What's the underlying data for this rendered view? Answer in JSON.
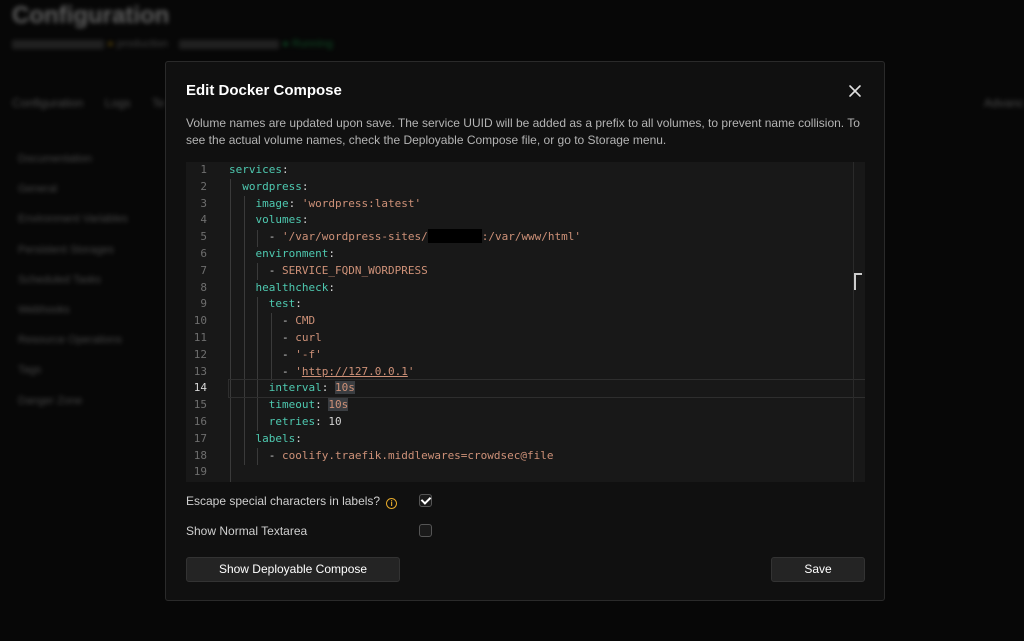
{
  "background": {
    "page_title": "Configuration",
    "breadcrumb": [
      "",
      "production",
      "",
      "Running"
    ],
    "tabs": [
      "Configuration",
      "Logs",
      "Te"
    ],
    "right_link": "Advanc",
    "sidebar": [
      "Documentation",
      "General",
      "Environment Variables",
      "Persistent Storages",
      "Scheduled Tasks",
      "Webhooks",
      "Resource Operations",
      "Tags",
      "Danger Zone"
    ]
  },
  "modal": {
    "title": "Edit Docker Compose",
    "close_icon": "close-icon",
    "description": "Volume names are updated upon save. The service UUID will be added as a prefix to all volumes, to prevent name collision. To see the actual volume names, check the Deployable Compose file, or go to Storage menu.",
    "editor": {
      "active_line": 14,
      "lines": [
        {
          "n": "1"
        },
        {
          "n": "2"
        },
        {
          "n": "3"
        },
        {
          "n": "4"
        },
        {
          "n": "5"
        },
        {
          "n": "6"
        },
        {
          "n": "7"
        },
        {
          "n": "8"
        },
        {
          "n": "9"
        },
        {
          "n": "10"
        },
        {
          "n": "11"
        },
        {
          "n": "12"
        },
        {
          "n": "13"
        },
        {
          "n": "14"
        },
        {
          "n": "15"
        },
        {
          "n": "16"
        },
        {
          "n": "17"
        },
        {
          "n": "18"
        },
        {
          "n": "19"
        }
      ],
      "code": {
        "services": "services",
        "wordpress": "wordpress",
        "image_key": "image",
        "image_val": "'wordpress:latest'",
        "volumes_key": "volumes",
        "volume_prefix": "'/var/wordpress-sites/",
        "volume_suffix": ":/var/www/html'",
        "environment_key": "environment",
        "env_val": "SERVICE_FQDN_WORDPRESS",
        "healthcheck_key": "healthcheck",
        "test_key": "test",
        "test_1": "CMD",
        "test_2": "curl",
        "test_3": "'-f'",
        "test_4_q": "'",
        "test_4_url": "http://127.0.0.1",
        "test_4_end": "'",
        "interval_key": "interval",
        "interval_val": "10s",
        "timeout_key": "timeout",
        "timeout_val": "10s",
        "retries_key": "retries",
        "retries_val": "10",
        "labels_key": "labels",
        "label_val": "coolify.traefik.middlewares=crowdsec@file"
      }
    },
    "options": {
      "escape_label": "Escape special characters in labels?",
      "escape_checked": true,
      "textarea_label": "Show Normal Textarea",
      "textarea_checked": false,
      "info_icon": "info-icon"
    },
    "buttons": {
      "show_deployable": "Show Deployable Compose",
      "save": "Save"
    }
  }
}
